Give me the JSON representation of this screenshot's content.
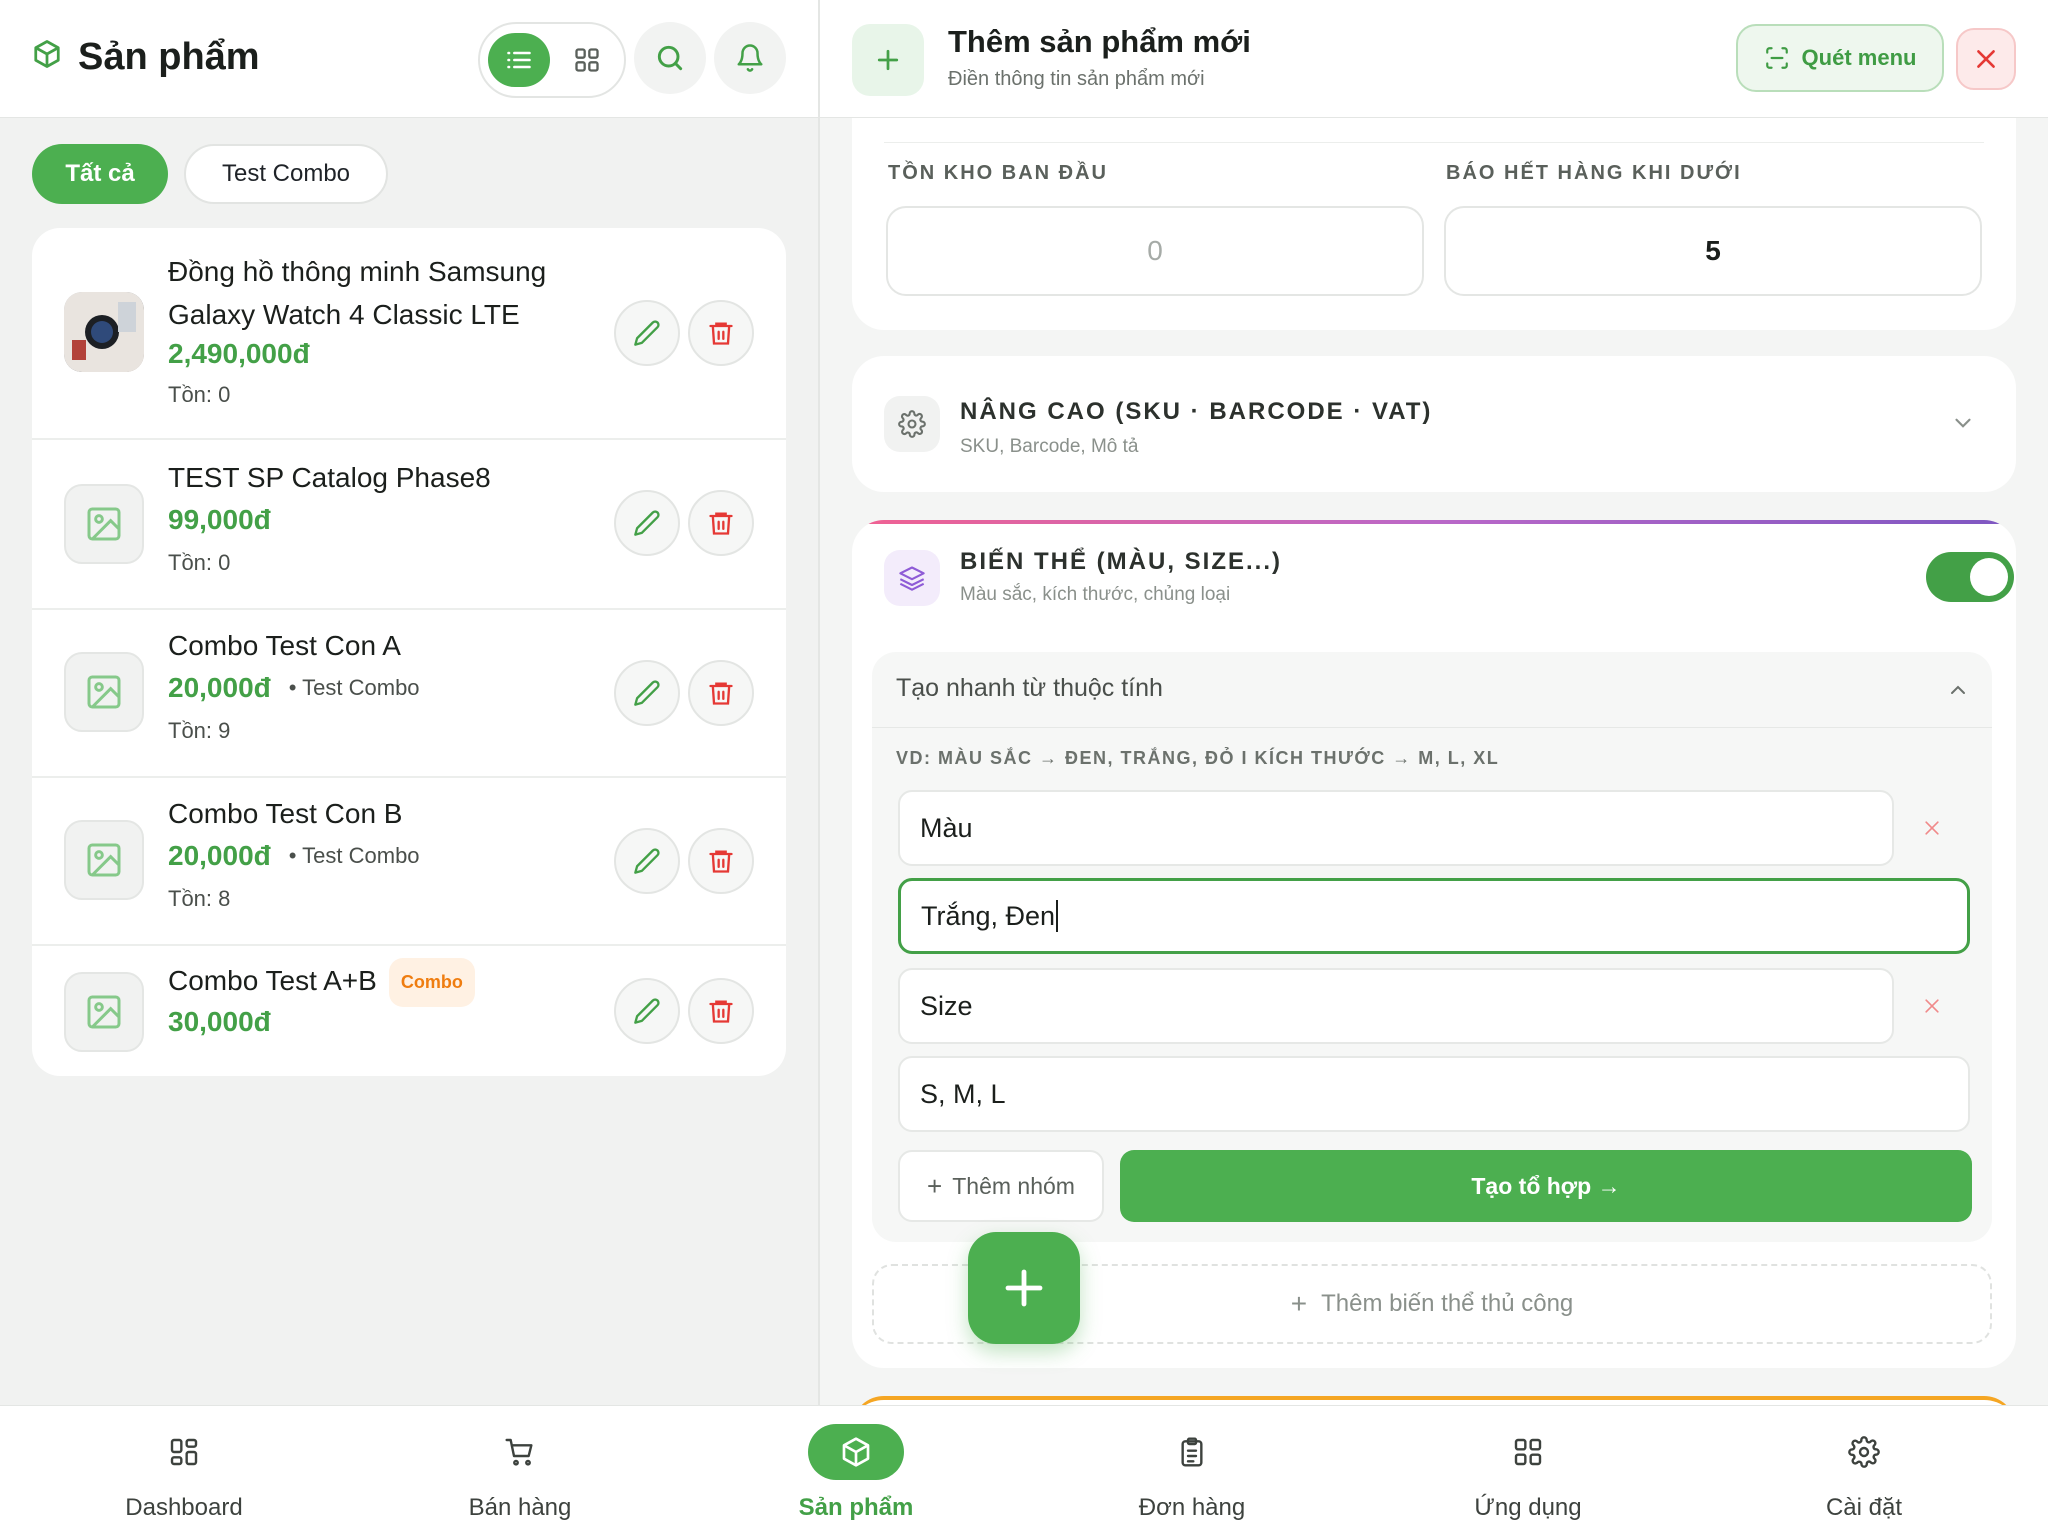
{
  "left": {
    "title": "Sản phẩm",
    "filters": [
      "Tất cả",
      "Test Combo"
    ],
    "products": [
      {
        "name": "Đồng hồ thông minh Samsung Galaxy Watch 4 Classic LTE",
        "price": "2,490,000đ",
        "category": "",
        "stock": "Tồn: 0",
        "badge": ""
      },
      {
        "name": "TEST SP Catalog Phase8",
        "price": "99,000đ",
        "category": "",
        "stock": "Tồn: 0",
        "badge": ""
      },
      {
        "name": "Combo Test Con A",
        "price": "20,000đ",
        "category": "• Test Combo",
        "stock": "Tồn: 9",
        "badge": ""
      },
      {
        "name": "Combo Test Con B",
        "price": "20,000đ",
        "category": "• Test Combo",
        "stock": "Tồn: 8",
        "badge": ""
      },
      {
        "name": "Combo Test A+B",
        "price": "30,000đ",
        "category": "",
        "stock": "",
        "badge": "Combo"
      }
    ]
  },
  "right": {
    "title": "Thêm sản phẩm mới",
    "subtitle": "Điền thông tin sản phẩm mới",
    "scan_label": "Quét menu",
    "stock": {
      "initial_label": "TỒN KHO BAN ĐẦU",
      "initial_value": "0",
      "alert_label": "BÁO HẾT HÀNG KHI DƯỚI",
      "alert_value": "5"
    },
    "advanced": {
      "title": "NÂNG CAO (SKU · BARCODE · VAT)",
      "subtitle": "SKU, Barcode, Mô tả"
    },
    "variants": {
      "title": "BIẾN THỂ (MÀU, SIZE...)",
      "subtitle": "Màu sắc, kích thước, chủng loại",
      "enabled": true,
      "quick_title": "Tạo nhanh từ thuộc tính",
      "hint": "VD: MÀU SẮC → ĐEN, TRẮNG, ĐỎ I KÍCH THƯỚC → M, L, XL",
      "groups": [
        {
          "name": "Màu",
          "values": "Trắng, Đen"
        },
        {
          "name": "Size",
          "values": "S, M, L"
        }
      ],
      "add_group": "Thêm nhóm",
      "combine": "Tạo tổ hợp →",
      "manual": "Thêm biến thể thủ công"
    }
  },
  "nav": [
    {
      "label": "Dashboard",
      "icon": "dashboard-icon",
      "active": false
    },
    {
      "label": "Bán hàng",
      "icon": "cart-icon",
      "active": false
    },
    {
      "label": "Sản phẩm",
      "icon": "box-icon",
      "active": true
    },
    {
      "label": "Đơn hàng",
      "icon": "clipboard-icon",
      "active": false
    },
    {
      "label": "Ứng dụng",
      "icon": "apps-icon",
      "active": false
    },
    {
      "label": "Cài đặt",
      "icon": "settings-icon",
      "active": false
    }
  ],
  "colors": {
    "accent": "#4caf50",
    "price": "#43a047",
    "danger": "#e53935",
    "badge": "#ef7d10"
  }
}
